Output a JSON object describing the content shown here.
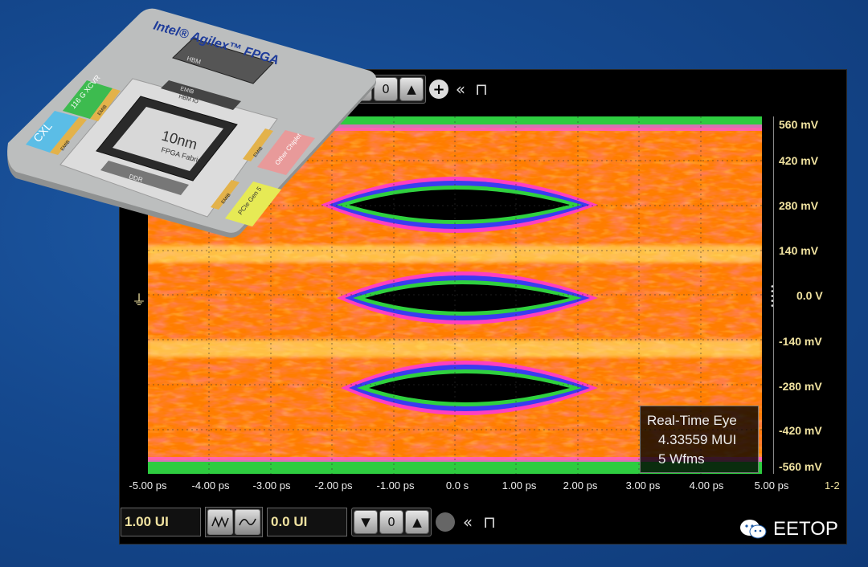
{
  "chip": {
    "title": "Intel® Agilex™ FPGA",
    "core_label": "10nm",
    "core_sub": "FPGA Fabric",
    "hbm": "HBM",
    "emib_top": "EMIB",
    "hbm_io": "HBM IO",
    "xcvr": "116 G XCVR",
    "emib_left_top": "EMIB",
    "cxl": "CXL",
    "emib_left": "EMIB",
    "ddr": "DDR",
    "emib_right": "EMIB",
    "other_chiplet": "Other Chiplet",
    "emib_bottom": "EMIB",
    "pcie": "PCIe Gen 5"
  },
  "toolbar": {
    "down_icon": "chevron-down-icon",
    "zero_icon": "zero-icon",
    "up_icon": "chevron-up-icon",
    "plus_icon": "zoom-plus-icon",
    "collapse_icon": "double-left-icon",
    "pin_icon": "pin-icon"
  },
  "y_axis": {
    "ticks": [
      "560 mV",
      "420 mV",
      "280 mV",
      "140 mV",
      "0.0 V",
      "-140 mV",
      "-280 mV",
      "-420 mV",
      "-560 mV"
    ]
  },
  "x_axis": {
    "ticks": [
      "-5.00 ps",
      "-4.00 ps",
      "-3.00 ps",
      "-2.00 ps",
      "-1.00 ps",
      "0.0 s",
      "1.00 ps",
      "2.00 ps",
      "3.00 ps",
      "4.00 ps",
      "5.00 ps"
    ],
    "extra": "1-2"
  },
  "readout": {
    "title": "Real-Time Eye",
    "ui": "4.33559 MUI",
    "wfms": "5 Wfms"
  },
  "bottom": {
    "ui_field": "1.00 UI",
    "offset_field": "0.0 UI"
  },
  "watermark": {
    "text": "EETOP"
  }
}
